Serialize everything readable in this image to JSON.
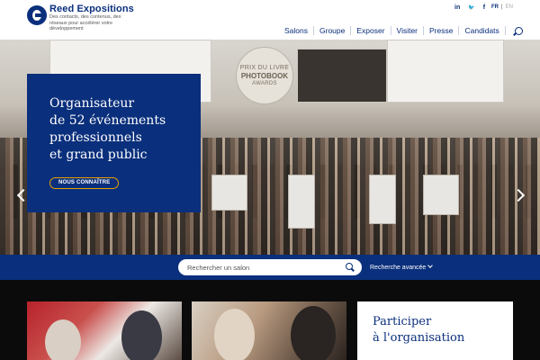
{
  "brand": {
    "name": "Reed Expositions",
    "tagline": "Des contacts, des contenus, des réseaux pour accélérer votre développement"
  },
  "socials": [
    {
      "icon": "linkedin-icon",
      "glyph": "in"
    },
    {
      "icon": "twitter-icon",
      "glyph": "🐦"
    },
    {
      "icon": "facebook-icon",
      "glyph": "f"
    }
  ],
  "languages": {
    "active": "FR",
    "separator": "|",
    "other": "EN"
  },
  "nav": {
    "items": [
      "Salons",
      "Groupe",
      "Exposer",
      "Visiter",
      "Presse",
      "Candidats"
    ]
  },
  "hero": {
    "title_lines": [
      "Organisateur",
      "de 52 événements",
      "professionnels",
      "et grand public"
    ],
    "cta": "NOUS CONNAÎTRE",
    "prize": {
      "line1": "PRIX DU LIVRE",
      "line2": "PHOTOBOOK",
      "line3": "AWARDS"
    }
  },
  "search": {
    "placeholder": "Rechercher un salon",
    "advanced_label": "Recherche avancée"
  },
  "cards": {
    "third_title_lines": [
      "Participer",
      "à l'organisation"
    ]
  },
  "colors": {
    "brand_blue": "#0a2f7c",
    "accent_orange": "#e6a000",
    "footer_black": "#0b0b0b"
  }
}
